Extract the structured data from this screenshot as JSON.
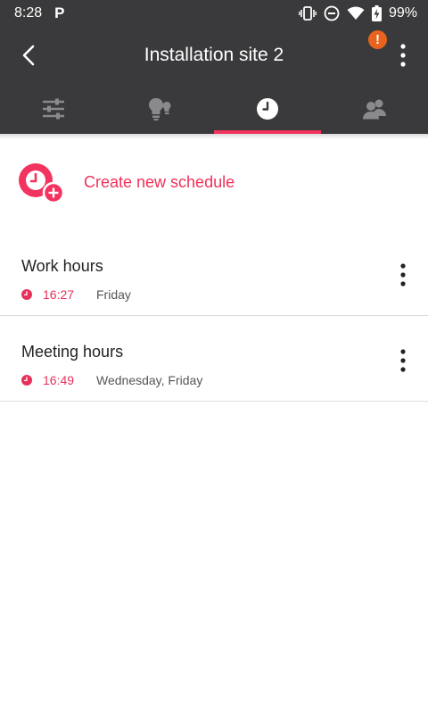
{
  "status_bar": {
    "time": "8:28",
    "app_badge": "P",
    "battery": "99%"
  },
  "app_bar": {
    "title": "Installation site 2",
    "alert_badge": "!"
  },
  "tabs": [
    {
      "icon": "sliders-icon",
      "active": false
    },
    {
      "icon": "bulbs-icon",
      "active": false
    },
    {
      "icon": "clock-icon",
      "active": true
    },
    {
      "icon": "users-icon",
      "active": false
    }
  ],
  "create": {
    "label": "Create new schedule"
  },
  "schedules": [
    {
      "name": "Work hours",
      "time": "16:27",
      "days": "Friday"
    },
    {
      "name": "Meeting hours",
      "time": "16:49",
      "days": "Wednesday, Friday"
    }
  ],
  "colors": {
    "header": "#3a3a3c",
    "accent": "#f2335f",
    "alert": "#e8641e"
  }
}
